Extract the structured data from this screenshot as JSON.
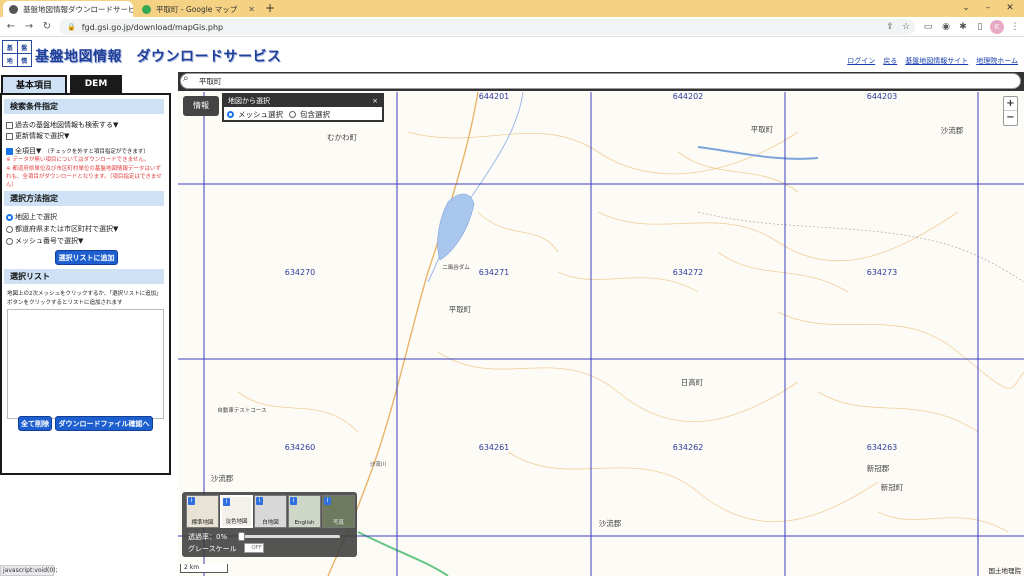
{
  "browser": {
    "tabs": [
      {
        "title": "基盤地図情報ダウンロードサービス",
        "active": true
      },
      {
        "title": "平取町 - Google マップ",
        "active": false
      }
    ],
    "new_tab": "+",
    "url": "fgd.gsi.go.jp/download/mapGis.php",
    "window_controls": {
      "minimize": "–",
      "maximize": "□",
      "close": "✕"
    },
    "profile_initial": "K"
  },
  "site": {
    "logo_chars": [
      "基",
      "盤",
      "地",
      "情"
    ],
    "title": "基盤地図情報　ダウンロードサービス",
    "links": [
      "ログイン",
      "戻る",
      "基盤地図情報サイト",
      "地理院ホーム"
    ]
  },
  "panel": {
    "tabs": [
      "基本項目",
      "DEM"
    ],
    "search_condition": {
      "heading": "検索条件指定",
      "opt_past": "過去の基盤地図情報も検索する▼",
      "opt_updated": "更新情報で選択▼",
      "opt_all": "全項目▼",
      "opt_all_note": "（チェックを外すと項目指定ができます）",
      "note1": "※ データが無い項目についてはダウンロードできません。",
      "note2": "※ 都道府県単位及び市区町村単位の基盤地図情報データはいずれも、全項目がダウンロードとなります。（項目指定はできません）"
    },
    "select_method": {
      "heading": "選択方法指定",
      "opt_map": "地図上で選択",
      "opt_pref": "都道府県または市区町村で選択▼",
      "opt_mesh": "メッシュ番号で選択▼",
      "add_button": "選択リストに追加"
    },
    "select_list": {
      "heading": "選択リスト",
      "desc": "地図上の2次メッシュをクリックするか、「選択リストに追加」ボタンをクリックするとリストに追加されます",
      "delete_all": "全て削除",
      "confirm_button": "ダウンロードファイル確認へ"
    }
  },
  "map": {
    "search_value": "平取町",
    "info_button": "情報",
    "popup": {
      "title": "地図から選択",
      "close": "×",
      "option_mesh": "メッシュ選択",
      "option_contain": "包含選択"
    },
    "zoom_in": "+",
    "zoom_out": "−",
    "mesh_labels": [
      "644201",
      "644202",
      "644203",
      "634270",
      "634271",
      "634272",
      "634273",
      "634260",
      "634261",
      "634262",
      "634263"
    ],
    "place_labels": [
      "むかわ町",
      "平取町",
      "沙流郡",
      "平取町",
      "日高町",
      "沙流郡",
      "新冠郡",
      "新冠町",
      "沙流郡",
      "自動車テストコース",
      "二風谷ダム",
      "沙流川"
    ],
    "layers": {
      "items": [
        "標準地図",
        "淡色地図",
        "白地図",
        "English",
        "写真"
      ],
      "badge": "i",
      "opacity_label": "透過率：0%",
      "grayscale_label": "グレースケール",
      "grayscale_state": "OFF",
      "opacity": 0
    },
    "scale": "2 km",
    "attribution": "国土地理院"
  },
  "statusbar": "javascript:void(0);"
}
